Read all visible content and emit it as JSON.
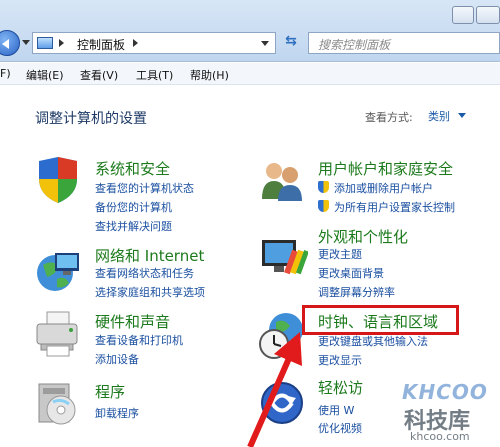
{
  "address_bar": {
    "crumbs": [
      "控制面板"
    ],
    "search_placeholder": "搜索控制面板"
  },
  "menu": [
    "F)",
    "编辑(E)",
    "查看(V)",
    "工具(T)",
    "帮助(H)"
  ],
  "page": {
    "title": "调整计算机的设置",
    "view_label": "查看方式:",
    "view_value": "类别"
  },
  "categories_left": [
    {
      "icon": "shield-icon",
      "title": "系统和安全",
      "links": [
        "查看您的计算机状态",
        "备份您的计算机",
        "查找并解决问题"
      ]
    },
    {
      "icon": "network-globe-icon",
      "title": "网络和 Internet",
      "links": [
        "查看网络状态和任务",
        "选择家庭组和共享选项"
      ]
    },
    {
      "icon": "printer-icon",
      "title": "硬件和声音",
      "links": [
        "查看设备和打印机",
        "添加设备"
      ]
    },
    {
      "icon": "programs-disc-icon",
      "title": "程序",
      "links": [
        "卸载程序"
      ]
    }
  ],
  "categories_right": [
    {
      "icon": "users-icon",
      "title": "用户帐户和家庭安全",
      "links": [
        "添加或删除用户帐户",
        "为所有用户设置家长控制"
      ]
    },
    {
      "icon": "appearance-icon",
      "title": "外观和个性化",
      "links": [
        "更改主题",
        "更改桌面背景",
        "调整屏幕分辨率"
      ]
    },
    {
      "icon": "clock-globe-icon",
      "title": "时钟、语言和区域",
      "links": [
        "更改键盘或其他输入法",
        "更改显示"
      ]
    },
    {
      "icon": "ease-of-access-icon",
      "title": "轻松访",
      "links": [
        "使用 W",
        "优化视频"
      ]
    }
  ],
  "watermark": {
    "logo": "KHCOO",
    "name": "科技库",
    "url": "khcoo.com"
  },
  "colors": {
    "title_green": "#1c7a1c",
    "link_blue": "#1a4fa0",
    "highlight_red": "#d51717"
  }
}
